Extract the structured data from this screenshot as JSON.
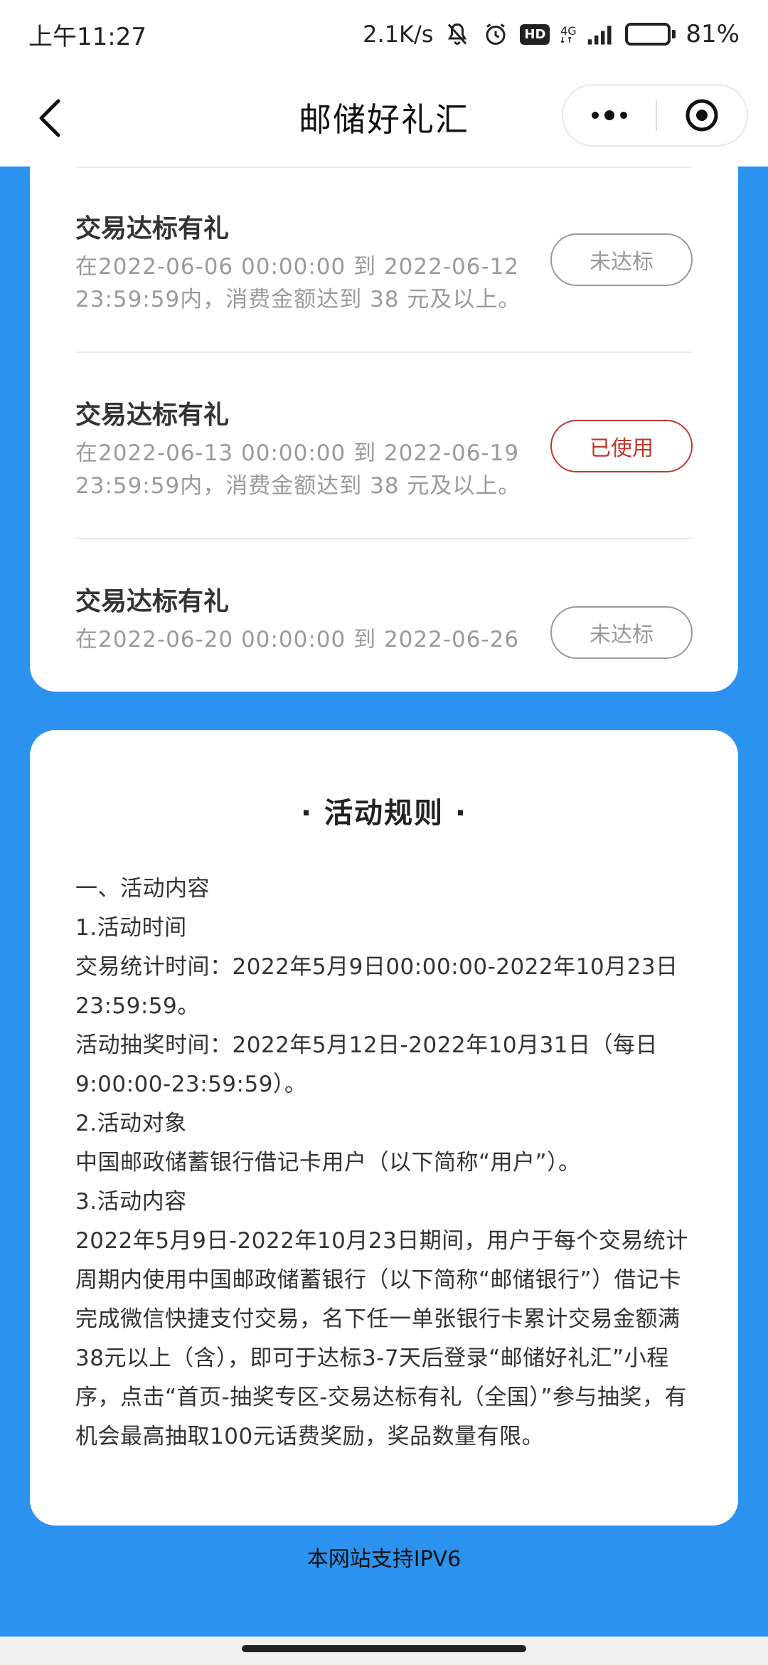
{
  "status_bar": {
    "time": "上午11:27",
    "net_speed": "2.1K/s",
    "hd": "HD",
    "network_type": "4G",
    "battery": "81%",
    "battery_level": 0.81
  },
  "nav": {
    "title": "邮储好礼汇"
  },
  "tasks": [
    {
      "title": "交易达标有礼",
      "desc_line1": "在2022-06-06 00:00:00 到 2022-06-12",
      "desc_line2": "23:59:59内，消费金额达到 38 元及以上。",
      "status": "未达标"
    },
    {
      "title": "交易达标有礼",
      "desc_line1": "在2022-06-13 00:00:00 到 2022-06-19",
      "desc_line2": "23:59:59内，消费金额达到 38 元及以上。",
      "status": "已使用"
    },
    {
      "title": "交易达标有礼",
      "desc_line1": "在2022-06-20 00:00:00 到 2022-06-26",
      "desc_line2": "",
      "status": "未达标"
    }
  ],
  "rules": {
    "title": "· 活动规则 ·",
    "lines": [
      "一、活动内容",
      "1.活动时间",
      "交易统计时间：2022年5月9日00:00:00-2022年10月23日23:59:59。",
      "活动抽奖时间：2022年5月12日-2022年10月31日（每日9:00:00-23:59:59）。",
      "2.活动对象",
      "中国邮政储蓄银行借记卡用户（以下简称“用户”）。",
      "3.活动内容",
      "2022年5月9日-2022年10月23日期间，用户于每个交易统计周期内使用中国邮政储蓄银行（以下简称“邮储银行”）借记卡完成微信快捷支付交易，名下任一单张银行卡累计交易金额满38元以上（含），即可于达标3-7天后登录“邮储好礼汇”小程序，点击“首页-抽奖专区-交易达标有礼（全国）”参与抽奖，有机会最高抽取100元话费奖励，奖品数量有限。"
    ]
  },
  "footer": {
    "note": "本网站支持IPV6"
  }
}
